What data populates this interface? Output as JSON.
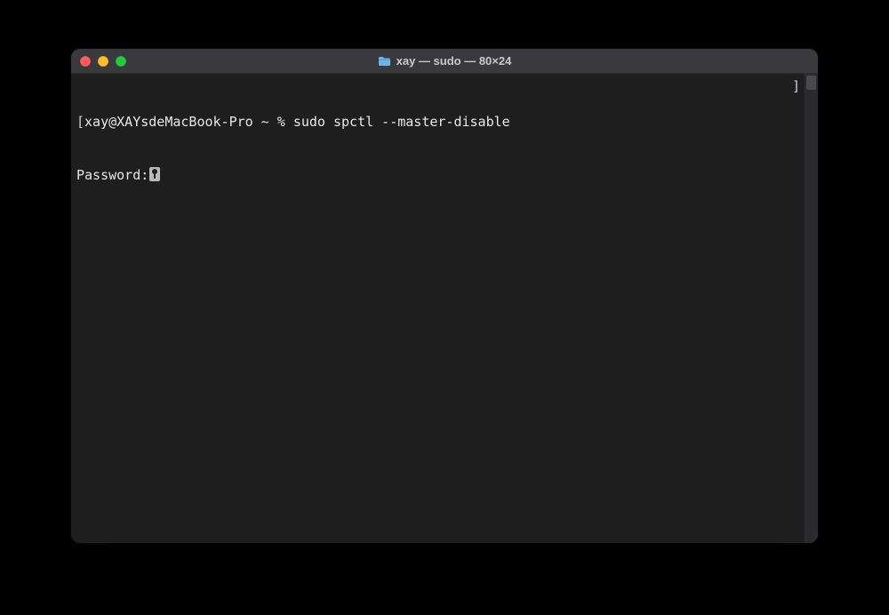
{
  "window": {
    "title": "xay — sudo — 80×24"
  },
  "terminal": {
    "prompt_open": "[",
    "prompt_text": "xay@XAYsdeMacBook-Pro ~ % ",
    "command": "sudo spctl --master-disable",
    "prompt_close": "]",
    "line2": {
      "label": "Password:",
      "icon_name": "key-icon"
    }
  }
}
